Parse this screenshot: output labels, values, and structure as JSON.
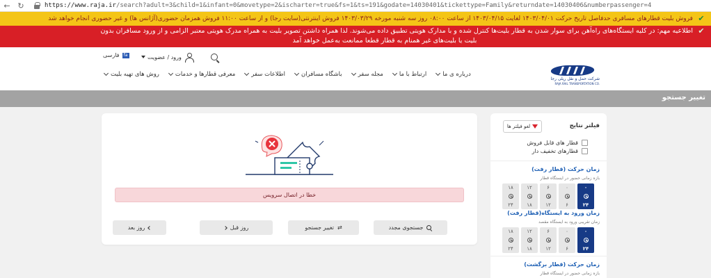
{
  "browser": {
    "back": "←",
    "refresh": "↻",
    "url_host": "https://www.raja.ir",
    "url_path": "/search?adult=3&child=1&infant=0&movetype=2&ischarter=true&fs=1&ts=191&godate=14030401&tickettype=Family&returndate=14030406&numberpassenger=4"
  },
  "banner_yellow": "فروش بلیت قطارهای مسافری حدفاصل تاریخ حرکت ۱۴۰۳/۰۴/۰۱ لغایت ۱۴۰۳/۰۴/۱۵ از ساعت ۰۸:۰۰ روز سه شنبه مورخه ۱۴۰۳/۰۳/۲۹ فروش اینترنتی(سایت رجا) و از ساعت ۱۱:۰۰ فروش همزمان حضوری(آژانس ها) و غیر حضوری انجام خواهد شد",
  "banner_red": {
    "line1": "اطلاعیه مهم: در کلیه ایستگاه‌های راه‌آهن برای سوار شدن به قطار بلیت‌ها کنترل شده و با مدارک هویتی تطبیق داده می‌شوند. لذا همراه داشتن تصویر بلیت به همراه مدرک هویتی معتبر الزامی و از ورود مسافران بدون",
    "line2": "بلیت یا بلیت‌های غیر همنام به قطار قطعا ممانعت به‌عمل خواهد آمد"
  },
  "header": {
    "language": "فارسی",
    "flag_text": "fa",
    "login": "ورود / عضویت",
    "menu": [
      "روش های تهیه بلیت",
      "معرفی قطارها و خدمات",
      "اطلاعات سفر",
      "باشگاه مسافران",
      "مجله سفر",
      "ارتباط با ما",
      "درباره ی ما"
    ],
    "logo_line1": "شرکت حمل و نقل ریلی رجا",
    "logo_line2": "RAJA RAIL TRANSPORTATION CO."
  },
  "graybar": {
    "title": "تغییر جستجو"
  },
  "main": {
    "error_text": "خطا در اتصال سرویس",
    "buttons": {
      "search_again": "جستجوی مجدد",
      "change_search": "تغییر جستجو",
      "prev_day": "روز قبل",
      "next_day": "روز بعد"
    }
  },
  "sidebar": {
    "title": "فیلتر نتایج",
    "clear_filters": "لغو فیلتر ها",
    "checkboxes": [
      "قطار های قابل فروش",
      "قطارهای تخفیف دار"
    ],
    "sections": [
      {
        "title": "زمان حرکت (قطار رفت)",
        "subtitle": "بازه زمانی حضور در ایستگاه قطار",
        "slots": [
          {
            "top": "۰",
            "bottom": "۲۴",
            "active": true
          },
          {
            "top": "۰",
            "bottom": "۶",
            "active": false
          },
          {
            "top": "۶",
            "bottom": "۱۲",
            "active": false
          },
          {
            "top": "۱۲",
            "bottom": "۱۸",
            "active": false
          },
          {
            "top": "۱۸",
            "bottom": "۲۴",
            "active": false
          }
        ]
      },
      {
        "title": "زمان ورود به ایستگاه(قطار رفت)",
        "subtitle": "زمان تقریبی ورود به ایستگاه مقصد",
        "slots": [
          {
            "top": "۰",
            "bottom": "۲۴",
            "active": true
          },
          {
            "top": "۰",
            "bottom": "۶",
            "active": false
          },
          {
            "top": "۶",
            "bottom": "۱۲",
            "active": false
          },
          {
            "top": "۱۲",
            "bottom": "۱۸",
            "active": false
          },
          {
            "top": "۱۸",
            "bottom": "۲۴",
            "active": false
          }
        ]
      },
      {
        "title": "زمان حرکت (قطار برگشت)",
        "subtitle": "بازه زمانی حضور در ایستگاه قطار"
      }
    ]
  },
  "colors": {
    "accent": "#173a86",
    "alert_red": "#d81f26",
    "banner_yellow": "#f4c517",
    "link_blue": "#1d5fb4"
  }
}
